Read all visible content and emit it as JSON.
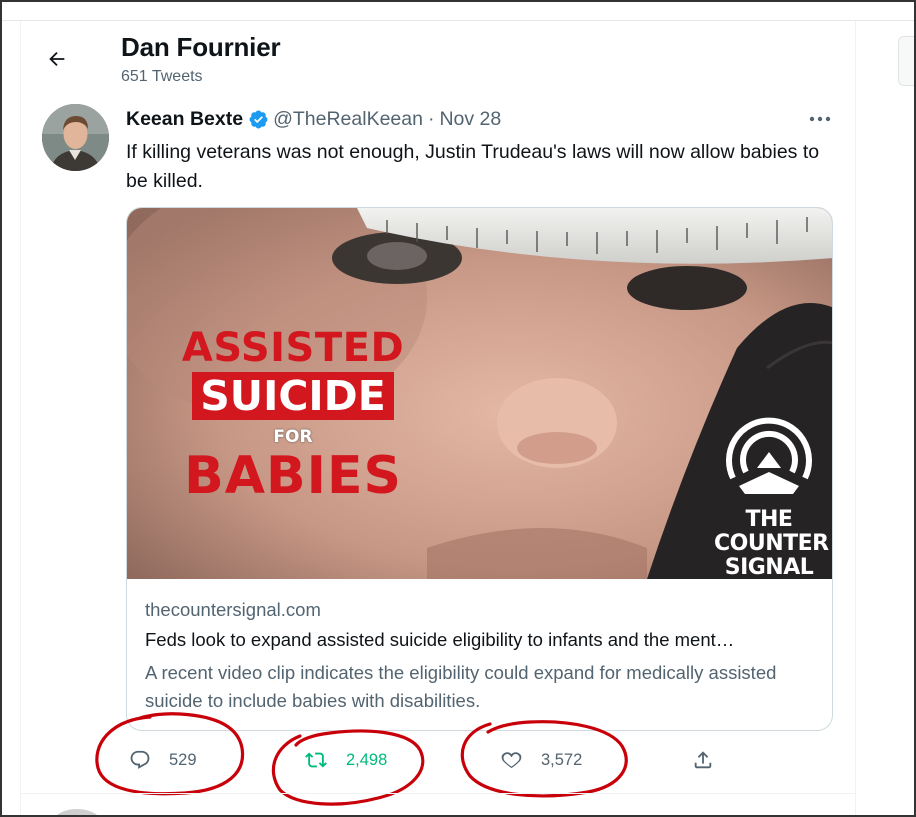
{
  "header": {
    "profile_name": "Dan Fournier",
    "tweet_count": "651 Tweets"
  },
  "tweet": {
    "author_name": "Keean Bexte",
    "handle": "@TheRealKeean",
    "separator": "·",
    "date": "Nov 28",
    "text": "If killing veterans was not enough, Justin Trudeau's laws will now allow babies to be killed."
  },
  "card": {
    "image": {
      "line1": "ASSISTED",
      "line2": "SUICIDE",
      "line3": "FOR",
      "line4": "BABIES",
      "logo_line1": "THE",
      "logo_line2": "COUNTER",
      "logo_line3": "SIGNAL"
    },
    "domain": "thecountersignal.com",
    "title": "Feds look to expand assisted suicide eligibility to infants and the ment…",
    "description": "A recent video clip indicates the eligibility could expand for medically assisted suicide to include babies with disabilities."
  },
  "actions": {
    "replies": "529",
    "retweets": "2,498",
    "likes": "3,572"
  },
  "colors": {
    "accent_red": "#d3171f",
    "retweet_green": "#00ba7c",
    "verified_blue": "#1d9bf0",
    "annotation_red": "#c8000a",
    "muted_text": "#536471"
  },
  "icons": [
    "back-arrow-icon",
    "verified-badge-icon",
    "more-options-icon",
    "reply-icon",
    "retweet-icon",
    "like-icon",
    "share-icon"
  ]
}
